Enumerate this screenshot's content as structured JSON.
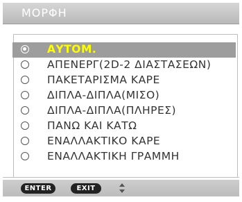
{
  "window": {
    "title": "ΜΟΡΦΗ"
  },
  "options": [
    {
      "label": "ΑΥΤΟΜ.",
      "selected": true
    },
    {
      "label": "ΑΠΕΝΕΡΓ(2D-2 ΔΙΑΣΤΑΣΕΩΝ)",
      "selected": false
    },
    {
      "label": "ΠΑΚΕΤΑΡΙΣΜΑ ΚΑΡΕ",
      "selected": false
    },
    {
      "label": "ΔΙΠΛΑ-ΔΙΠΛΑ(ΜΙΣΟ)",
      "selected": false
    },
    {
      "label": "ΔΙΠΛΑ-ΔΙΠΛΑ(ΠΛΗΡΕΣ)",
      "selected": false
    },
    {
      "label": "ΠΑΝΩ ΚΑΙ ΚΑΤΩ",
      "selected": false
    },
    {
      "label": "ΕΝΑΛΛΑΚΤΙΚΟ ΚΑΡΕ",
      "selected": false
    },
    {
      "label": "ΕΝΑΛΛΑΚΤΙΚΗ ΓΡΑΜΜΗ",
      "selected": false
    }
  ],
  "footer": {
    "enter_label": "ENTER",
    "exit_label": "EXIT",
    "nav_icon": "up-down-arrows-icon"
  },
  "colors": {
    "selected_row": "#9d9d9d",
    "selected_text": "#ffff00",
    "title_bar": "#c8c8c8",
    "text": "#333333"
  }
}
